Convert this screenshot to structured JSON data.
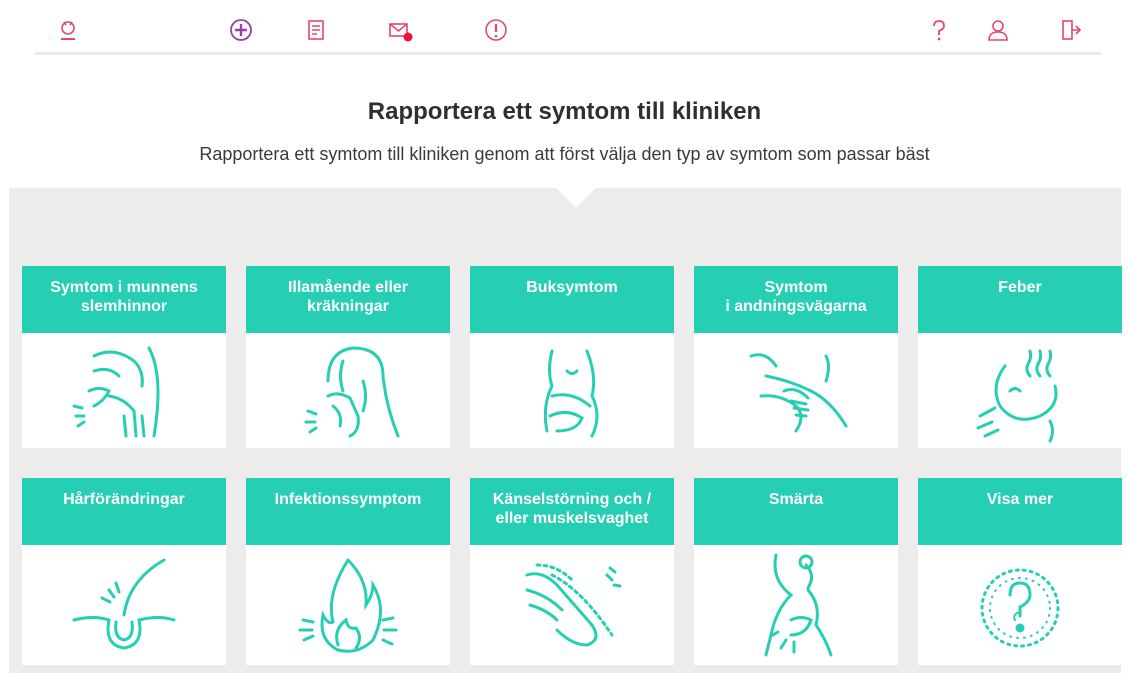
{
  "topbar": {
    "icons": [
      {
        "name": "logo-icon"
      },
      {
        "name": "add-circle-icon"
      },
      {
        "name": "document-icon"
      },
      {
        "name": "mail-icon",
        "badge": "0"
      },
      {
        "name": "alert-icon"
      },
      {
        "name": "help-icon"
      },
      {
        "name": "user-icon"
      },
      {
        "name": "logout-icon"
      }
    ]
  },
  "header": {
    "title": "Rapportera ett symtom till kliniken",
    "subtitle": "Rapportera ett symtom till kliniken genom att först välja den typ av symtom som passar bäst"
  },
  "cards": [
    {
      "line1": "Symtom i munnens",
      "line2": "slemhinnor",
      "icon": "mouth-icon"
    },
    {
      "line1": "Illamående eller",
      "line2": "kräkningar",
      "icon": "nausea-icon"
    },
    {
      "line1": "Buksymtom",
      "line2": "",
      "icon": "stomach-icon"
    },
    {
      "line1": "Symtom",
      "line2": "i andningsvägarna",
      "icon": "breathing-icon"
    },
    {
      "line1": "Feber",
      "line2": "",
      "icon": "fever-icon"
    },
    {
      "line1": "Hårförändringar",
      "line2": "",
      "icon": "hair-icon"
    },
    {
      "line1": "Infektionssymptom",
      "line2": "",
      "icon": "infection-icon"
    },
    {
      "line1": "Känselstörning och /",
      "line2": "eller muskelsvaghet",
      "icon": "numbness-icon"
    },
    {
      "line1": "Smärta",
      "line2": "",
      "icon": "pain-icon"
    },
    {
      "line1": "Visa mer",
      "line2": "",
      "icon": "question-icon"
    }
  ],
  "colors": {
    "accent": "#26cfb4",
    "topbar_icons": "#e8456a",
    "add_icon": "#9b3fa8",
    "background_grey": "#ececec"
  }
}
